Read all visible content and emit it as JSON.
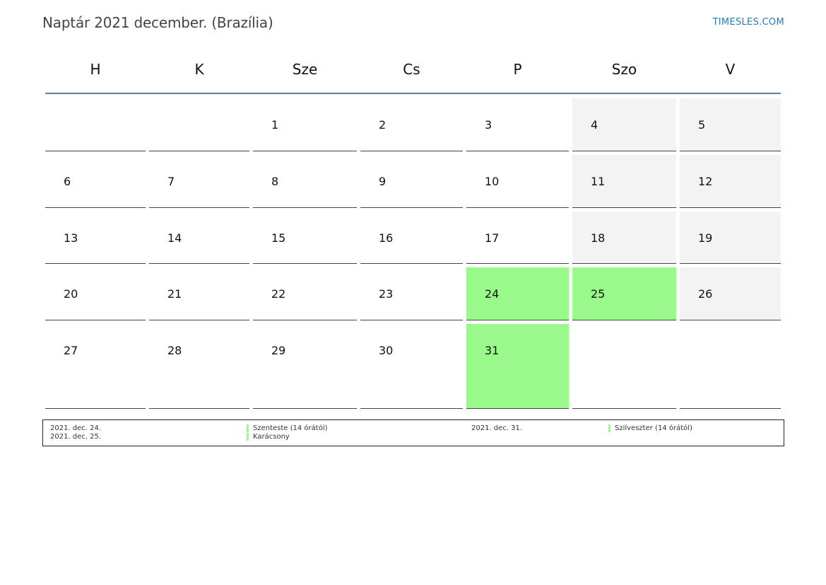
{
  "header": {
    "title": "Naptár 2021 december. (Brazília)",
    "brand": "TIMESLES.COM"
  },
  "weekdays": [
    "H",
    "K",
    "Sze",
    "Cs",
    "P",
    "Szo",
    "V"
  ],
  "weeks": [
    [
      {
        "day": "",
        "type": "empty"
      },
      {
        "day": "",
        "type": "empty"
      },
      {
        "day": "1",
        "type": "normal"
      },
      {
        "day": "2",
        "type": "normal"
      },
      {
        "day": "3",
        "type": "normal"
      },
      {
        "day": "4",
        "type": "weekend"
      },
      {
        "day": "5",
        "type": "weekend"
      }
    ],
    [
      {
        "day": "6",
        "type": "normal"
      },
      {
        "day": "7",
        "type": "normal"
      },
      {
        "day": "8",
        "type": "normal"
      },
      {
        "day": "9",
        "type": "normal"
      },
      {
        "day": "10",
        "type": "normal"
      },
      {
        "day": "11",
        "type": "weekend"
      },
      {
        "day": "12",
        "type": "weekend"
      }
    ],
    [
      {
        "day": "13",
        "type": "normal"
      },
      {
        "day": "14",
        "type": "normal"
      },
      {
        "day": "15",
        "type": "normal"
      },
      {
        "day": "16",
        "type": "normal"
      },
      {
        "day": "17",
        "type": "normal"
      },
      {
        "day": "18",
        "type": "weekend"
      },
      {
        "day": "19",
        "type": "weekend"
      }
    ],
    [
      {
        "day": "20",
        "type": "normal"
      },
      {
        "day": "21",
        "type": "normal"
      },
      {
        "day": "22",
        "type": "normal"
      },
      {
        "day": "23",
        "type": "normal"
      },
      {
        "day": "24",
        "type": "holiday"
      },
      {
        "day": "25",
        "type": "holiday"
      },
      {
        "day": "26",
        "type": "weekend"
      }
    ],
    [
      {
        "day": "27",
        "type": "normal"
      },
      {
        "day": "28",
        "type": "normal"
      },
      {
        "day": "29",
        "type": "normal"
      },
      {
        "day": "30",
        "type": "normal"
      },
      {
        "day": "31",
        "type": "holiday"
      },
      {
        "day": "",
        "type": "empty"
      },
      {
        "day": "",
        "type": "empty"
      }
    ]
  ],
  "legend": {
    "col1": [
      {
        "date": "2021. dec. 24.",
        "name": "Szenteste (14 órától)"
      },
      {
        "date": "2021. dec. 25.",
        "name": "Karácsony"
      }
    ],
    "col2": [
      {
        "date": "2021. dec. 31.",
        "name": "Szilveszter (14 órától)"
      }
    ]
  },
  "colors": {
    "holiday": "#99f98a",
    "weekend": "#f3f3f3",
    "header_rule": "#5d7fa3",
    "brand": "#2a7ab0"
  }
}
